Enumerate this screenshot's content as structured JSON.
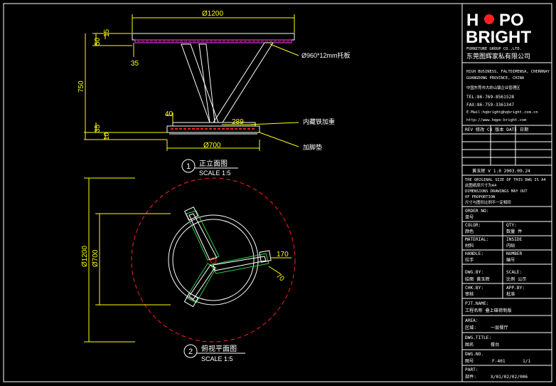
{
  "colors": {
    "background": "#000000",
    "frame": "#ffffff",
    "dimension": "#ffff00",
    "red": "#ff2020",
    "green": "#2ecc40",
    "magenta": "#ff40ff",
    "lines": "#ffffff"
  },
  "logo": {
    "line1": "H",
    "line1b": "PO",
    "line2": "BRIGHT",
    "company_en": "FURNITURE GROUP CO.,LTD.",
    "company_cn": "东莞图辉家私有限公司"
  },
  "contact": {
    "line1": "HIGH BUSINESS, FALTDIMENSA, CHERRNAY",
    "line2": "GUANGDONG PROVINCE, CHINA",
    "line3": "中国东莞市大岭山镇企业管理区",
    "tel": "TEL:86-769-8561528",
    "fax": "FAX:86-759-3361347",
    "email": "E-Mail:hqbright@hqbright.com.cn",
    "web": "http://www.hqpo-bright.com"
  },
  "rev_header": "REV 修改  CO 版本  DATE 日期",
  "designer_line": "黄玉辉  V 1.0  2003.09.24",
  "notes": {
    "n1": "THE ORIGINAL SIZE OF THIS DWG IS A4",
    "n2": "此图纸原尺寸为A4",
    "n3": "DIMENSIONS DRAWINGS MAY OUT",
    "n4": "OF PROPORTION",
    "n5": "尺寸与图形比例不一定相同"
  },
  "title_block": [
    {
      "en": "ORDER NO:",
      "cn": "单号",
      "val": "",
      "val2": ""
    },
    {
      "en": "COLOR:",
      "cn": "颜色",
      "val": "QTY:",
      "val2": "数量        件"
    },
    {
      "en": "MATERIAL:",
      "cn": "材料",
      "val": "INSIDE",
      "val2": "内贴"
    },
    {
      "en": "HANDLE:",
      "cn": "拉手",
      "val": "NUMBER",
      "val2": "编号"
    },
    {
      "en": "DWG.BY:",
      "cn": "绘图  黄玉辉",
      "val": "SCALE:",
      "val2": "比例  公示"
    },
    {
      "en": "CHK.BY:",
      "cn": "审核",
      "val": "APP.BY:",
      "val2": "批准"
    }
  ],
  "project": {
    "label": "PJT.NAME:",
    "value": "工程名称  叠上碟荷制版"
  },
  "area": {
    "label": "AREA:",
    "cn": "区域:",
    "value": "一层餐厅"
  },
  "dwg_title": {
    "label": "DWG.TITLE:",
    "cn": "图名",
    "value": "餐台"
  },
  "dwg_no": {
    "label": "DWG.NO.",
    "cn": "图号",
    "value": "F-401",
    "sheet": "1/1"
  },
  "part": {
    "label": "PART:",
    "cn": "部件:",
    "value": "X/01/02/02/006"
  },
  "drawing": {
    "dim_top": "Ø1200",
    "dim_15": "15",
    "dim_50": "50",
    "dim_35a": "35",
    "dim_750": "750",
    "dim_35b": "35",
    "dim_10": "10",
    "dim_40": "40",
    "dim_289": "289",
    "dim_700": "Ø700",
    "note_plate": "Ø960*12mm托板",
    "note_inner": "内藏铁加重",
    "note_base": "加脚垫",
    "view1_num": "1",
    "view1_title": "正立面图",
    "view1_scale": "SCALE 1:5",
    "plan_1200": "Ø1200",
    "plan_700": "Ø700",
    "plan_170": "170",
    "plan_70": "70",
    "view2_num": "2",
    "view2_title": "俯视平面图",
    "view2_scale": "SCALE 1:5"
  }
}
